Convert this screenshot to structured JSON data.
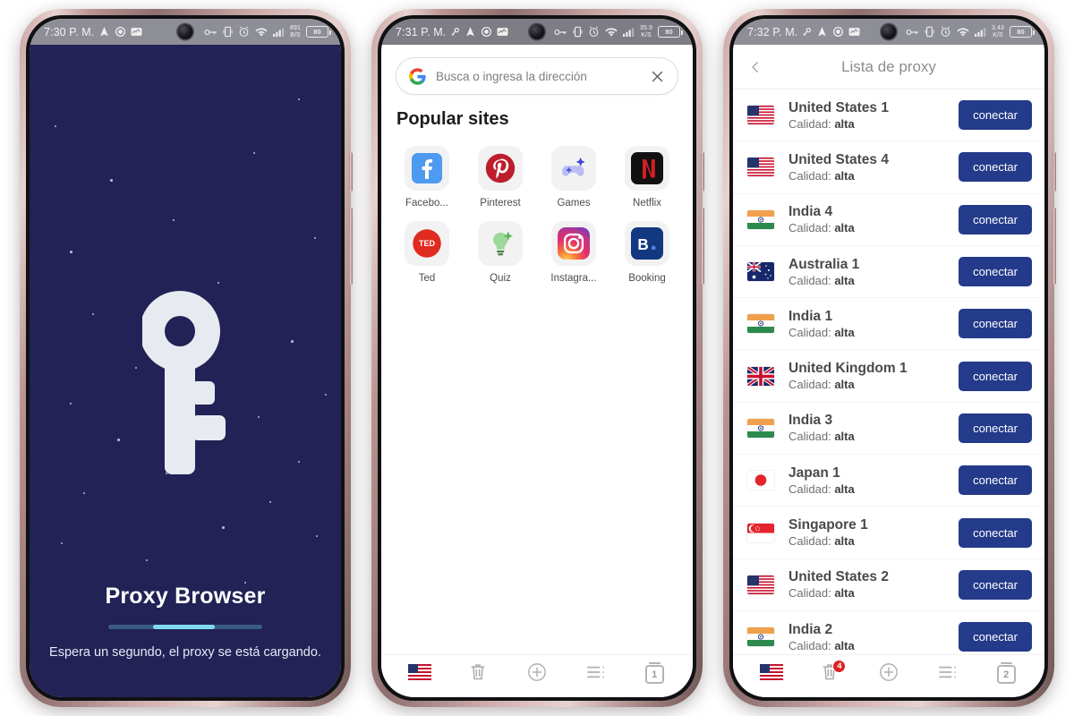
{
  "phones": [
    {
      "status": {
        "time": "7:30 P. M.",
        "net_speed_top": "891",
        "net_speed_bottom": "B/S",
        "battery": "80",
        "icons_left": [
          "location-icon",
          "record-icon",
          "chart-icon"
        ],
        "icons_right": [
          "vpn-key-icon",
          "vibrate-icon",
          "alarm-icon",
          "wifi-icon",
          "signal-icon"
        ]
      },
      "splash": {
        "logo": "key-icon",
        "title": "Proxy Browser",
        "subtitle": "Espera un segundo, el proxy se está cargando.",
        "progress_percent": 40,
        "bg_color": "#222256",
        "accent_color": "#7fd9f2"
      }
    },
    {
      "status": {
        "time": "7:31 P. M.",
        "net_speed_top": "35.9",
        "net_speed_bottom": "K/S",
        "battery": "80",
        "icons_left": [
          "key-small-icon",
          "location-icon",
          "record-icon",
          "chart-icon"
        ],
        "icons_right": [
          "vpn-key-icon",
          "vibrate-icon",
          "alarm-icon",
          "wifi-icon",
          "signal-icon"
        ]
      },
      "browser": {
        "search": {
          "placeholder": "Busca o ingresa la dirección",
          "value": "",
          "leading_icon": "google-g-icon",
          "trailing_icon": "close-icon"
        },
        "section_title": "Popular sites",
        "tiles": [
          {
            "label": "Facebo...",
            "icon": "facebook-icon"
          },
          {
            "label": "Pinterest",
            "icon": "pinterest-icon"
          },
          {
            "label": "Games",
            "icon": "games-icon"
          },
          {
            "label": "Netflix",
            "icon": "netflix-icon"
          },
          {
            "label": "Ted",
            "icon": "ted-icon"
          },
          {
            "label": "Quiz",
            "icon": "quiz-icon"
          },
          {
            "label": "Instagra...",
            "icon": "instagram-icon"
          },
          {
            "label": "Booking",
            "icon": "booking-icon"
          }
        ],
        "toolbar": {
          "flag": "us-flag-icon",
          "trash": "trash-icon",
          "trash_badge": "",
          "add": "add-circle-icon",
          "menu": "list-menu-icon",
          "tab_count": "1"
        }
      }
    },
    {
      "status": {
        "time": "7:32 P. M.",
        "net_speed_top": "3.43",
        "net_speed_bottom": "K/S",
        "battery": "80",
        "icons_left": [
          "key-small-icon",
          "location-icon",
          "record-icon",
          "chart-icon"
        ],
        "icons_right": [
          "vpn-key-icon",
          "vibrate-icon",
          "alarm-icon",
          "wifi-icon",
          "signal-icon"
        ]
      },
      "proxy": {
        "header": {
          "back_icon": "chevron-left-icon",
          "title": "Lista de proxy"
        },
        "quality_label": "Calidad:",
        "button_label": "conectar",
        "button_color": "#243a8a",
        "rows": [
          {
            "name": "United States 1",
            "quality": "alta",
            "flag": "us"
          },
          {
            "name": "United States 4",
            "quality": "alta",
            "flag": "us"
          },
          {
            "name": "India 4",
            "quality": "alta",
            "flag": "in"
          },
          {
            "name": "Australia 1",
            "quality": "alta",
            "flag": "au"
          },
          {
            "name": "India 1",
            "quality": "alta",
            "flag": "in"
          },
          {
            "name": "United Kingdom 1",
            "quality": "alta",
            "flag": "gb"
          },
          {
            "name": "India 3",
            "quality": "alta",
            "flag": "in"
          },
          {
            "name": "Japan 1",
            "quality": "alta",
            "flag": "jp"
          },
          {
            "name": "Singapore 1",
            "quality": "alta",
            "flag": "sg"
          },
          {
            "name": "United States 2",
            "quality": "alta",
            "flag": "us"
          },
          {
            "name": "India 2",
            "quality": "alta",
            "flag": "in"
          }
        ],
        "toolbar": {
          "flag": "us-flag-icon",
          "trash": "trash-icon",
          "trash_badge": "4",
          "add": "add-circle-icon",
          "menu": "list-menu-icon",
          "tab_count": "2"
        }
      }
    }
  ]
}
